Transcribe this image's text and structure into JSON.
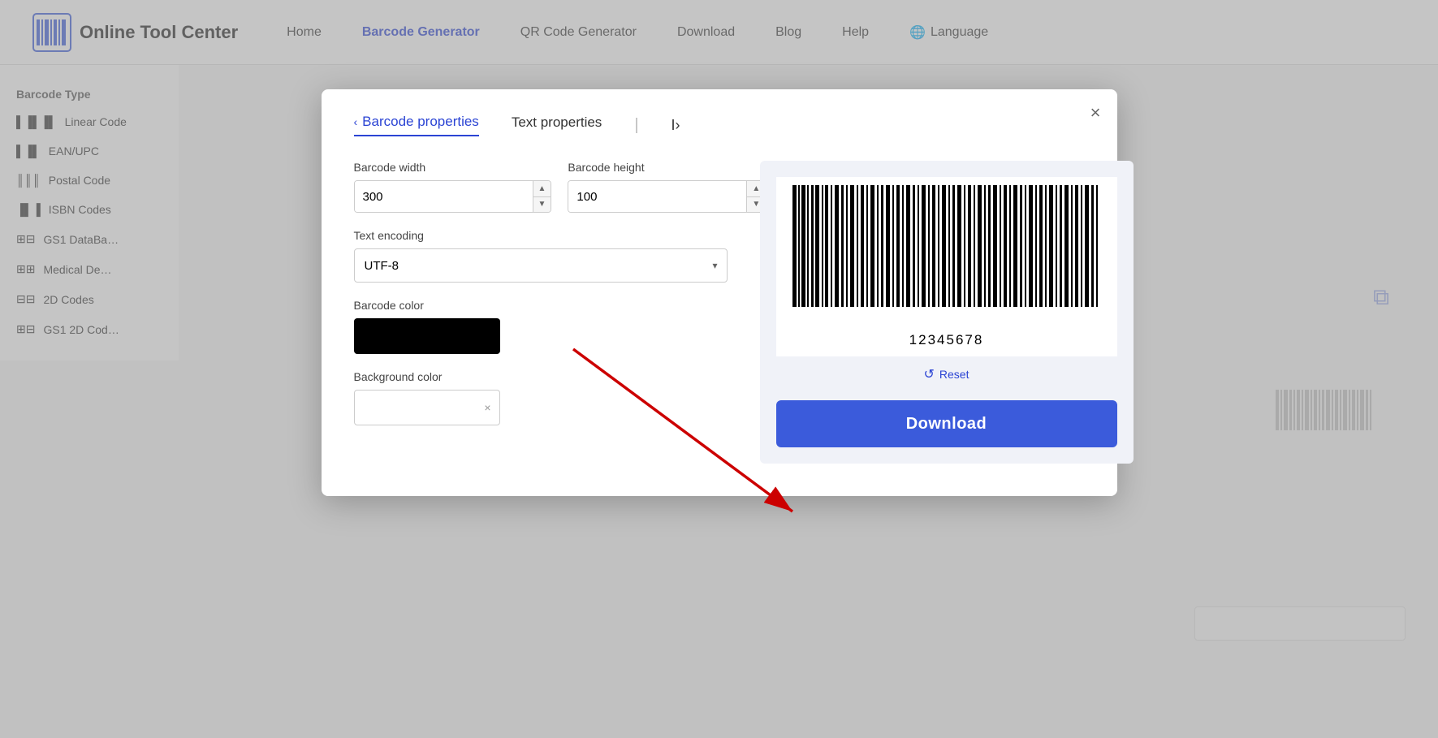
{
  "header": {
    "logo_text": "Online Tool Center",
    "nav_items": [
      {
        "label": "Home",
        "active": false
      },
      {
        "label": "Barcode Generator",
        "active": true
      },
      {
        "label": "QR Code Generator",
        "active": false
      },
      {
        "label": "Download",
        "active": false
      },
      {
        "label": "Blog",
        "active": false
      },
      {
        "label": "Help",
        "active": false
      },
      {
        "label": "Language",
        "active": false
      }
    ]
  },
  "sidebar": {
    "section_label": "Barcode Type",
    "items": [
      {
        "label": "Linear Code"
      },
      {
        "label": "EAN/UPC"
      },
      {
        "label": "Postal Code"
      },
      {
        "label": "ISBN Codes"
      },
      {
        "label": "GS1 DataBa…"
      },
      {
        "label": "Medical De…"
      },
      {
        "label": "2D Codes"
      },
      {
        "label": "GS1 2D Cod…"
      }
    ]
  },
  "modal": {
    "tab_barcode_props": "Barcode properties",
    "tab_text_props": "Text properties",
    "close_label": "×",
    "barcode_width_label": "Barcode width",
    "barcode_width_value": "300",
    "barcode_height_label": "Barcode height",
    "barcode_height_value": "100",
    "text_encoding_label": "Text encoding",
    "text_encoding_value": "UTF-8",
    "barcode_color_label": "Barcode color",
    "background_color_label": "Background color",
    "barcode_number": "12345678",
    "reset_label": "Reset",
    "download_label": "Download"
  },
  "icons": {
    "chevron_up": "▲",
    "chevron_down": "▼",
    "select_arrow": "▾",
    "globe": "🌐",
    "reset": "↺",
    "close": "×"
  }
}
